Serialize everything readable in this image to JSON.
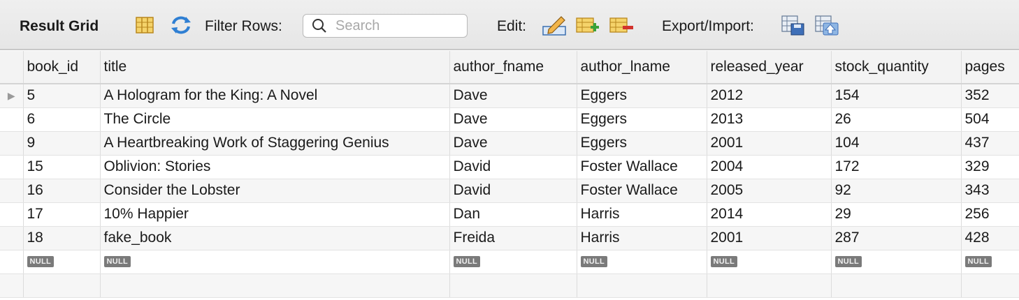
{
  "toolbar": {
    "title": "Result Grid",
    "filter_label": "Filter Rows:",
    "search_placeholder": "Search",
    "edit_label": "Edit:",
    "export_label": "Export/Import:"
  },
  "grid": {
    "columns": [
      "book_id",
      "title",
      "author_fname",
      "author_lname",
      "released_year",
      "stock_quantity",
      "pages"
    ],
    "rows": [
      [
        "5",
        "A Hologram for the King: A Novel",
        "Dave",
        "Eggers",
        "2012",
        "154",
        "352"
      ],
      [
        "6",
        "The Circle",
        "Dave",
        "Eggers",
        "2013",
        "26",
        "504"
      ],
      [
        "9",
        "A Heartbreaking Work of Staggering Genius",
        "Dave",
        "Eggers",
        "2001",
        "104",
        "437"
      ],
      [
        "15",
        "Oblivion: Stories",
        "David",
        "Foster Wallace",
        "2004",
        "172",
        "329"
      ],
      [
        "16",
        "Consider the Lobster",
        "David",
        "Foster Wallace",
        "2005",
        "92",
        "343"
      ],
      [
        "17",
        "10% Happier",
        "Dan",
        "Harris",
        "2014",
        "29",
        "256"
      ],
      [
        "18",
        "fake_book",
        "Freida",
        "Harris",
        "2001",
        "287",
        "428"
      ]
    ],
    "null_label": "NULL",
    "current_row_marker": "▶"
  }
}
